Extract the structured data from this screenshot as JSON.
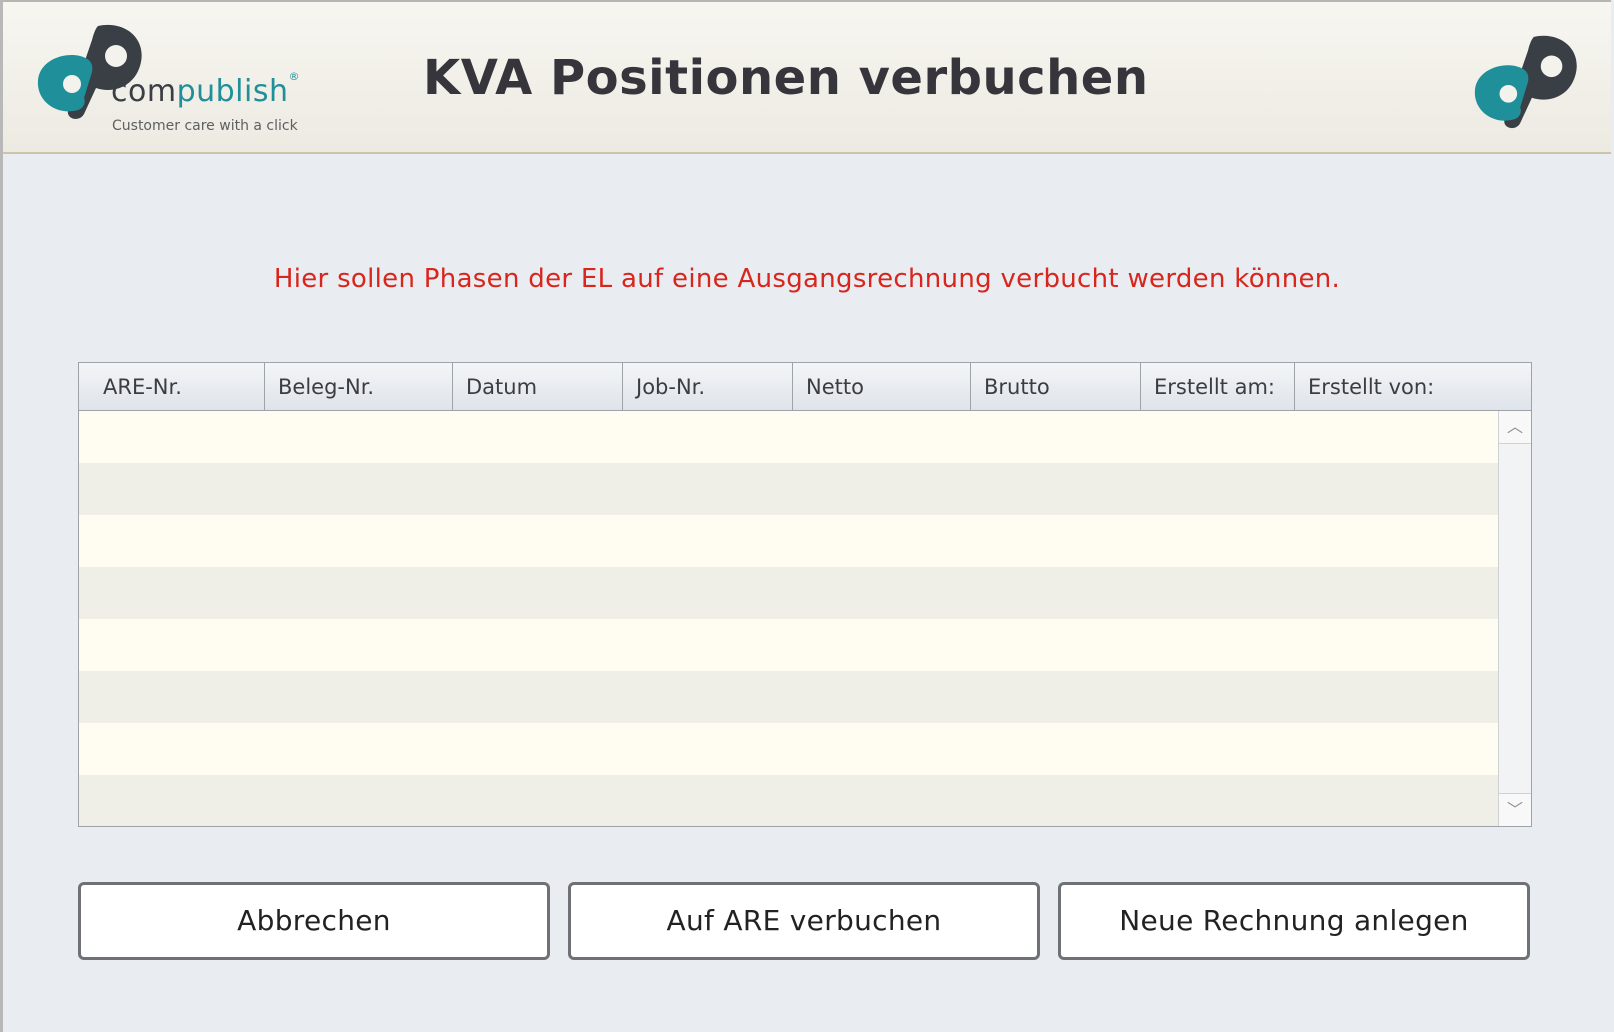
{
  "header": {
    "brand_com": "com",
    "brand_publish": "publish",
    "brand_reg": "®",
    "tagline": "Customer care with a click",
    "title": "KVA Positionen verbuchen"
  },
  "hint": "Hier sollen Phasen der EL auf eine Ausgangsrechnung verbucht werden können.",
  "table": {
    "columns": [
      "ARE-Nr.",
      "Beleg-Nr.",
      "Datum",
      "Job-Nr.",
      "Netto",
      "Brutto",
      "Erstellt am:",
      "Erstellt von:"
    ],
    "rows": []
  },
  "buttons": {
    "cancel": "Abbrechen",
    "book": "Auf ARE verbuchen",
    "new_invoice": "Neue Rechnung anlegen"
  },
  "colors": {
    "accent_teal": "#1f8f9a",
    "logo_dark": "#3a3f45",
    "hint_red": "#d9261c"
  }
}
